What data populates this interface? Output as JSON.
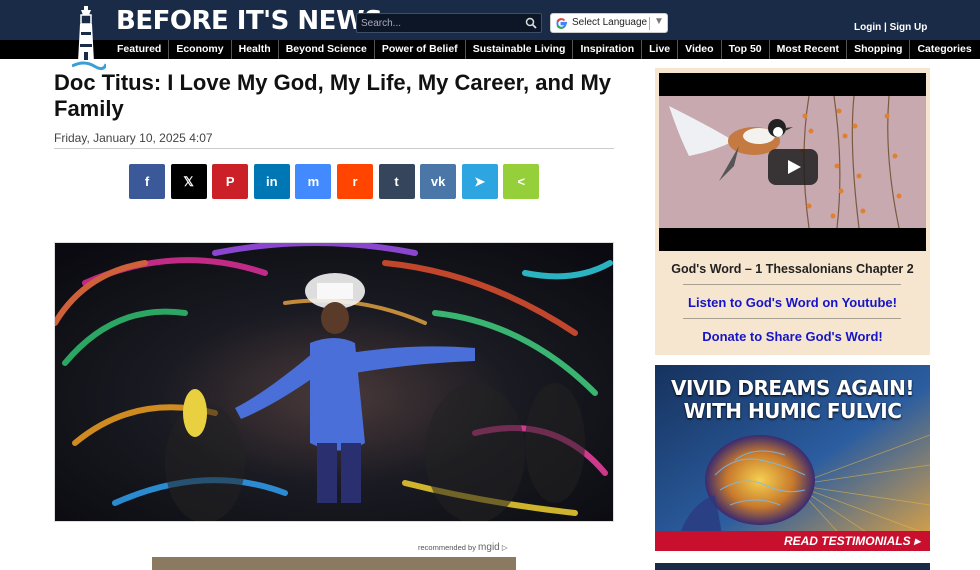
{
  "header": {
    "site_title": "BEFORE IT'S NEWS",
    "search_placeholder": "Search...",
    "language_label": "Select Language",
    "login_label": "Login",
    "signup_label": "Sign Up",
    "colors": {
      "topbar": "#1a2b47",
      "navbar": "#000000"
    }
  },
  "nav": {
    "items": [
      "Featured",
      "Economy",
      "Health",
      "Beyond Science",
      "Power of Belief",
      "Sustainable Living",
      "Inspiration",
      "Live",
      "Video",
      "Top 50",
      "Most Recent",
      "Shopping",
      "Categories"
    ]
  },
  "article": {
    "title": "Doc Titus: I Love My God, My Life, My Career, and My Family",
    "date": "Friday, January 10, 2025 4:07",
    "share_buttons": [
      {
        "icon": "facebook-icon",
        "glyph": "f",
        "color": "#3b5998"
      },
      {
        "icon": "x-icon",
        "glyph": "𝕏",
        "color": "#000000"
      },
      {
        "icon": "pinterest-icon",
        "glyph": "P",
        "color": "#cb2027"
      },
      {
        "icon": "linkedin-icon",
        "glyph": "in",
        "color": "#0077b5"
      },
      {
        "icon": "messenger-icon",
        "glyph": "m",
        "color": "#448aff"
      },
      {
        "icon": "reddit-icon",
        "glyph": "r",
        "color": "#ff4500"
      },
      {
        "icon": "tumblr-icon",
        "glyph": "t",
        "color": "#35465c"
      },
      {
        "icon": "vk-icon",
        "glyph": "vk",
        "color": "#4a76a8"
      },
      {
        "icon": "telegram-icon",
        "glyph": "➤",
        "color": "#2ca5e0"
      },
      {
        "icon": "share-icon",
        "glyph": "<",
        "color": "#95d03a"
      }
    ],
    "recommended_prefix": "recommended by",
    "recommended_brand": "mgid"
  },
  "sidebar": {
    "video_widget": {
      "title": "God's Word – 1 Thessalonians Chapter 2",
      "link1": "Listen to God's Word on Youtube!",
      "link2": "Donate to Share God's Word!"
    },
    "ad": {
      "headline_line1": "VIVID DREAMS AGAIN!",
      "headline_line2": "WITH HUMIC FULVIC",
      "cta": "READ TESTIMONIALS ▸"
    }
  }
}
